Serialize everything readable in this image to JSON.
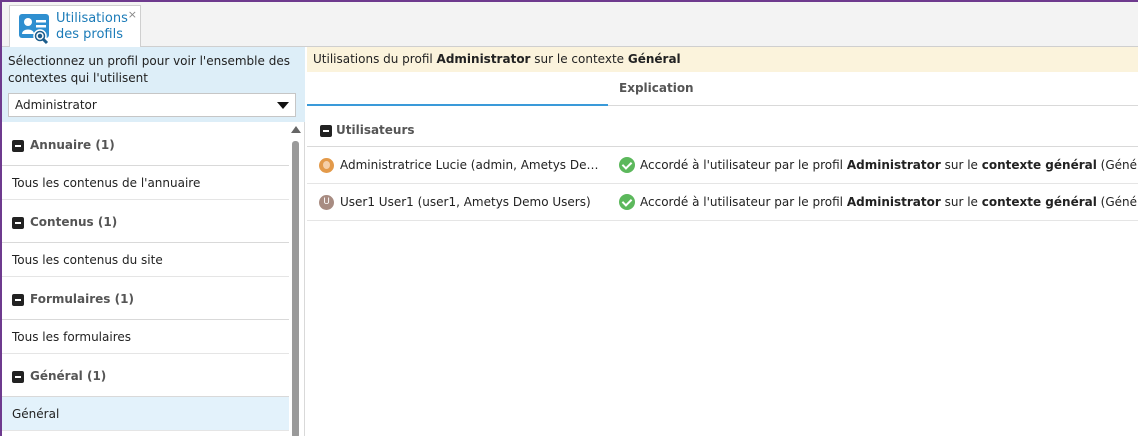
{
  "tab": {
    "label_line1": "Utilisations",
    "label_line2": "des profils",
    "close": "×",
    "icon": "profile-usage-icon"
  },
  "left": {
    "instruction": "Sélectionnez un profil pour voir l'ensemble des contextes qui l'utilisent",
    "profile_select": {
      "value": "Administrator"
    },
    "tree": [
      {
        "group": "Annuaire (1)",
        "items": [
          "Tous les contenus de l'annuaire"
        ]
      },
      {
        "group": "Contenus (1)",
        "items": [
          "Tous les contenus du site"
        ]
      },
      {
        "group": "Formulaires (1)",
        "items": [
          "Tous les formulaires"
        ]
      },
      {
        "group": "Général (1)",
        "items": [
          "Général"
        ]
      }
    ],
    "selected_item": "Général"
  },
  "right": {
    "title_prefix": "Utilisations du profil ",
    "title_profile": "Administrator",
    "title_middle": " sur le contexte ",
    "title_context": "Général",
    "column_explication": "Explication",
    "group": "Utilisateurs",
    "rows": [
      {
        "user": "Administratrice Lucie (admin, Ametys Demo Users)",
        "avatar": "photo",
        "expl_prefix": "Accordé à l'utilisateur par le profil ",
        "expl_profile": "Administrator",
        "expl_middle": " sur le ",
        "expl_context": "contexte général",
        "expl_suffix": " (Général)"
      },
      {
        "user": "User1 User1 (user1, Ametys Demo Users)",
        "avatar_initial": "U",
        "expl_prefix": "Accordé à l'utilisateur par le profil ",
        "expl_profile": "Administrator",
        "expl_middle": " sur le ",
        "expl_context": "contexte général",
        "expl_suffix": " (Général)"
      }
    ]
  },
  "colors": {
    "accent": "#1b7bb8",
    "frame": "#6e3a8e",
    "header_bg": "#fbf3dc",
    "left_head_bg": "#ddeef8",
    "success": "#5cb85c"
  }
}
